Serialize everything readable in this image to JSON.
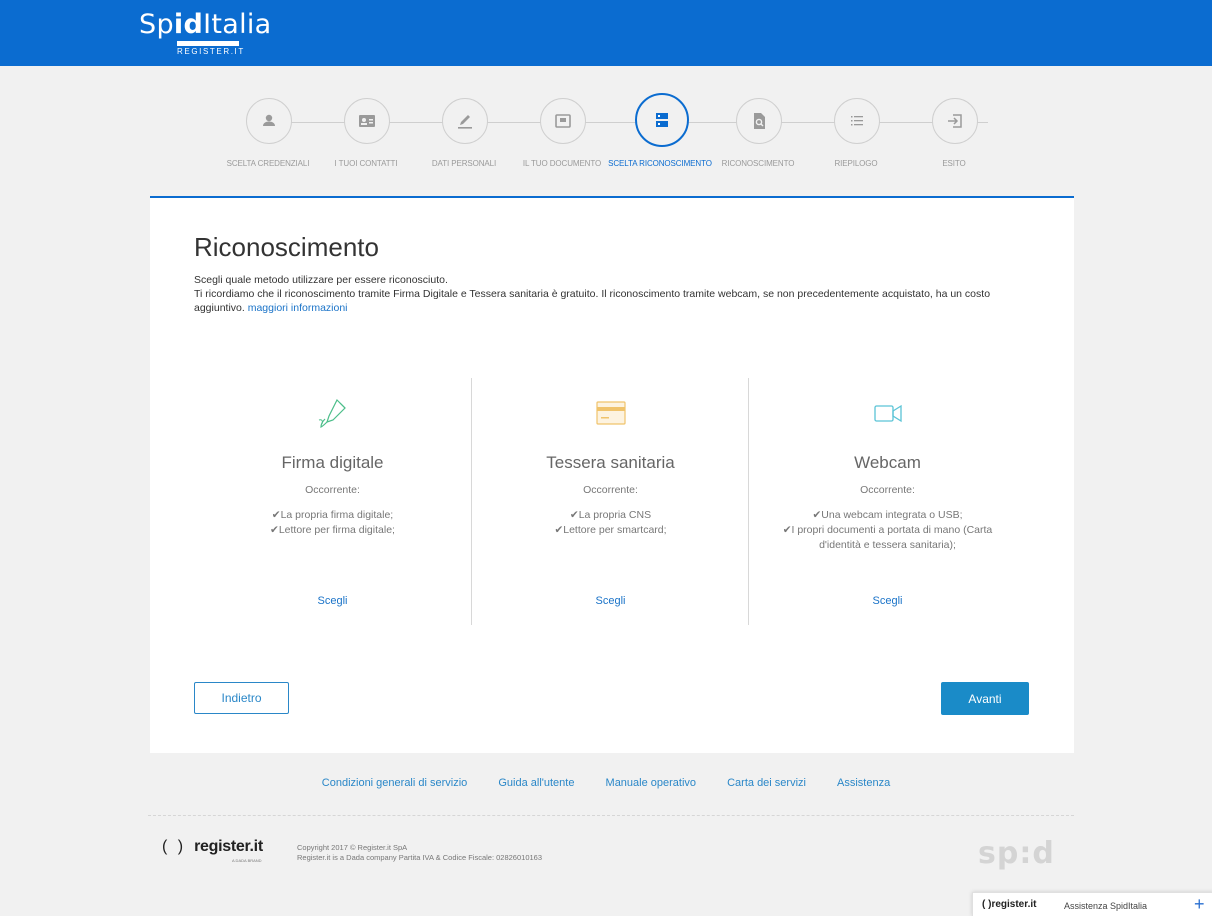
{
  "header": {
    "brand_main_prefix": "Sp",
    "brand_main_bold": "id",
    "brand_main_suffix": "Italia",
    "brand_sub": "REGISTER.IT"
  },
  "stepper": [
    {
      "label": "SCELTA CREDENZIALI",
      "icon": "user-icon",
      "active": false
    },
    {
      "label": "I TUOI CONTATTI",
      "icon": "contact-card-icon",
      "active": false
    },
    {
      "label": "DATI PERSONALI",
      "icon": "pencil-icon",
      "active": false
    },
    {
      "label": "IL TUO DOCUMENTO",
      "icon": "document-icon",
      "active": false
    },
    {
      "label": "SCELTA RICONOSCIMENTO",
      "icon": "server-icon",
      "active": true
    },
    {
      "label": "RICONOSCIMENTO",
      "icon": "file-search-icon",
      "active": false
    },
    {
      "label": "RIEPILOGO",
      "icon": "list-icon",
      "active": false
    },
    {
      "label": "ESITO",
      "icon": "sign-in-icon",
      "active": false
    }
  ],
  "page": {
    "title": "Riconoscimento",
    "intro_line1": "Scegli quale metodo utilizzare per essere riconosciuto.",
    "intro_line2": "Ti ricordiamo che il riconoscimento tramite Firma Digitale e Tessera sanitaria è gratuito. Il riconoscimento tramite webcam, se non precedentemente acquistato, ha un costo aggiuntivo.",
    "more_info_link": "maggiori informazioni"
  },
  "methods": [
    {
      "title": "Firma digitale",
      "subtitle": "Occorrente:",
      "req1": "✔La propria firma digitale;",
      "req2": "✔Lettore per firma digitale;",
      "link": "Scegli",
      "icon": "pen-nib-icon",
      "color": "#4cbe8a"
    },
    {
      "title": "Tessera sanitaria",
      "subtitle": "Occorrente:",
      "req1": "✔La propria CNS",
      "req2": "✔Lettore per smartcard;",
      "link": "Scegli",
      "icon": "credit-card-icon",
      "color": "#f0c36b"
    },
    {
      "title": "Webcam",
      "subtitle": "Occorrente:",
      "req1": "✔Una webcam integrata o USB;",
      "req2": "✔I propri documenti a portata di mano (Carta d'identità e tessera sanitaria);",
      "link": "Scegli",
      "icon": "video-camera-icon",
      "color": "#5bc4d6"
    }
  ],
  "buttons": {
    "back": "Indietro",
    "next": "Avanti"
  },
  "footer": {
    "links": [
      "Condizioni generali di servizio",
      "Guida all'utente",
      "Manuale operativo",
      "Carta dei servizi",
      "Assistenza"
    ],
    "register_paren": "( )",
    "register_name": "register.it",
    "register_tag": "A DADA BRAND",
    "copyright_line1": "Copyright 2017 © Register.it SpA",
    "copyright_line2": "Register.it is a Dada company Partita IVA & Codice Fiscale: 02826010163",
    "spid_logo": "sp:d"
  },
  "help_widget": {
    "logo": "( )register.it",
    "label": "Assistenza SpidItalia",
    "plus": "+"
  },
  "colors": {
    "primary": "#0b6cd0",
    "link": "#1a73c8",
    "button": "#1a8bc8"
  }
}
